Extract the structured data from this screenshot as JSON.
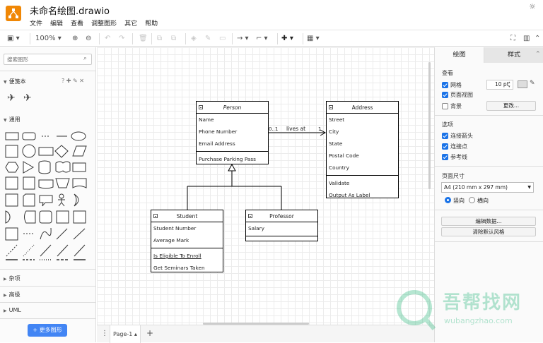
{
  "app": {
    "title": "未命名绘图.drawio",
    "menu": [
      "文件",
      "编辑",
      "查看",
      "调整图形",
      "其它",
      "帮助"
    ]
  },
  "toolbar": {
    "zoom": "100%"
  },
  "left_panel": {
    "search_placeholder": "搜索图形",
    "scratchpad": "便笺本",
    "general": "通用",
    "misc": "杂项",
    "advanced": "高级",
    "uml": "UML",
    "more_shapes": "+ 更多图形"
  },
  "bottom_bar": {
    "page_tab": "Page-1"
  },
  "right_panel": {
    "tab_diagram": "绘图",
    "tab_style": "样式",
    "view": {
      "heading": "查看",
      "grid_label": "网格",
      "grid_checked": true,
      "grid_size": "10 pt",
      "page_view_label": "页面视图",
      "page_view_checked": true,
      "background_label": "背景",
      "background_checked": false,
      "change_button": "更改..."
    },
    "options": {
      "heading": "选项",
      "items": [
        {
          "label": "连接箭头",
          "checked": true
        },
        {
          "label": "连接点",
          "checked": true
        },
        {
          "label": "参考线",
          "checked": true
        }
      ]
    },
    "page_size": {
      "heading": "页面尺寸",
      "selected": "A4 (210 mm x 297 mm)",
      "orientation_portrait": "竖向",
      "orientation_landscape": "横向",
      "portrait_selected": true
    },
    "edit_data_button": "编辑数据...",
    "clear_style_button": "清除默认风格"
  },
  "diagram": {
    "person": {
      "name": "Person",
      "attributes": [
        "Name",
        "Phone Number",
        "Email Address"
      ],
      "methods": [
        "Purchase Parking Pass"
      ]
    },
    "address": {
      "name": "Address",
      "attributes": [
        "Street",
        "City",
        "State",
        "Postal Code",
        "Country"
      ],
      "methods": [
        "Validate",
        "Output As Label"
      ]
    },
    "student": {
      "name": "Student",
      "attributes": [
        "Student Number",
        "Average Mark"
      ],
      "methods": [
        "Is Eligible To Enroll",
        "Get Seminars Taken"
      ]
    },
    "professor": {
      "name": "Professor",
      "attributes": [
        "Salary"
      ]
    },
    "association": {
      "label": "lives at",
      "mult_left": "0..1",
      "mult_right": "1"
    }
  },
  "watermark": {
    "text": "吾帮找网",
    "url": "wubangzhao.com"
  },
  "colors": {
    "accent": "#f08705",
    "button_blue": "#4285f4",
    "checkbox_blue": "#1a73e8"
  }
}
